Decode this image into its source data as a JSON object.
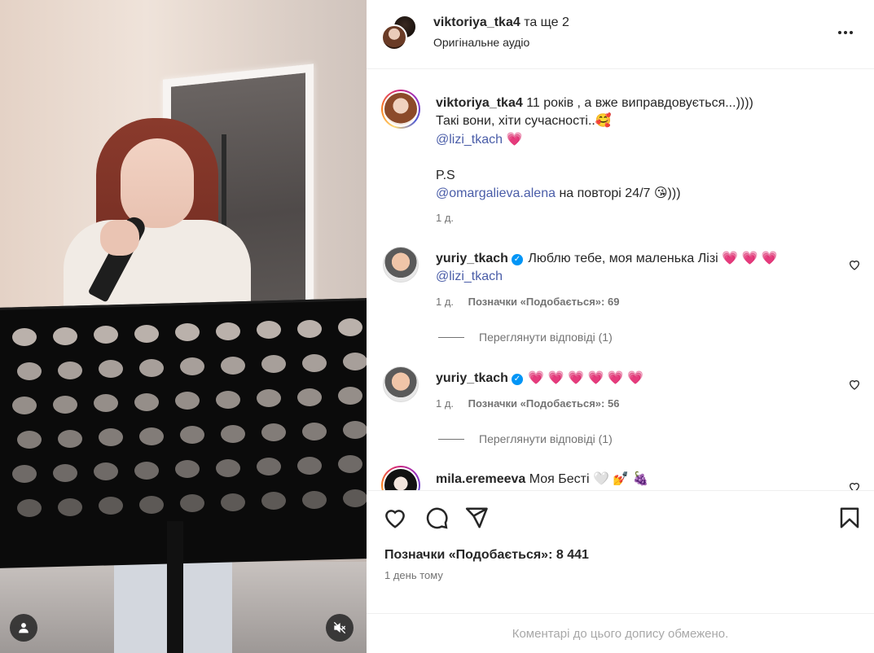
{
  "header": {
    "username": "viktoriya_tka4",
    "coauthors_text": "та ще 2",
    "audio": "Оригінальне аудіо",
    "more_icon": "more-horizontal-icon"
  },
  "caption": {
    "username": "viktoriya_tka4",
    "line1": "11 років , а вже виправдовується...))))",
    "line2": "Такі вони, хіти сучасності..🥰",
    "mention1": "@lizi_tkach",
    "mention1_emoji": "💗",
    "ps": "P.S",
    "mention2": "@omargalieva.alena",
    "line3": "на повторі 24/7 😘)))",
    "time": "1 д."
  },
  "comments": [
    {
      "username": "yuriy_tkach",
      "verified": true,
      "text": "Люблю тебе, моя маленька Лізі 💗 💗 💗",
      "mention": "@lizi_tkach",
      "time": "1 д.",
      "likes": "Позначки «Подобається»: 69",
      "replies": "Переглянути відповіді (1)"
    },
    {
      "username": "yuriy_tkach",
      "verified": true,
      "text": "💗 💗 💗 💗 💗 💗",
      "time": "1 д.",
      "likes": "Позначки «Подобається»: 56",
      "replies": "Переглянути відповіді (1)"
    },
    {
      "username": "mila.eremeeva",
      "verified": false,
      "text": "Моя Бесті 🤍 💅 🍇"
    }
  ],
  "actions": {
    "like_icon": "heart-icon",
    "comment_icon": "comment-icon",
    "share_icon": "send-icon",
    "save_icon": "bookmark-icon"
  },
  "likes_text": "Позначки «Подобається»: 8 441",
  "post_time": "1 день тому",
  "comments_limited": "Коментарі до цього допису обмежено.",
  "colors": {
    "link": "#4a5da8",
    "verified": "#0095f6",
    "muted": "#737373",
    "heart": "#e8336e"
  }
}
